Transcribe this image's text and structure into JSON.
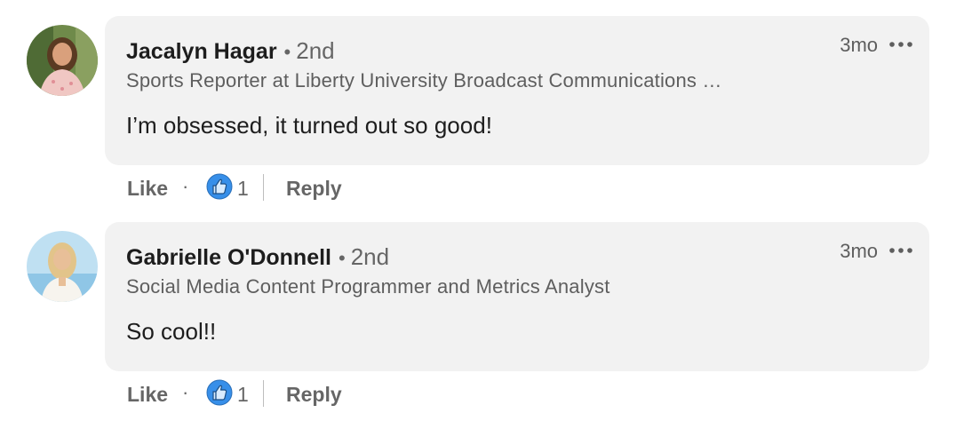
{
  "comments": [
    {
      "author": "Jacalyn Hagar",
      "degree": "2nd",
      "headline": "Sports Reporter at Liberty University Broadcast Communications …",
      "text": "I’m obsessed, it turned out so good!",
      "time": "3mo",
      "like_label": "Like",
      "reaction_count": "1",
      "reply_label": "Reply",
      "separator": "·",
      "degree_bullet": "•"
    },
    {
      "author": "Gabrielle O'Donnell",
      "degree": "2nd",
      "headline": "Social Media Content Programmer and Metrics Analyst",
      "text": "So cool!!",
      "time": "3mo",
      "like_label": "Like",
      "reaction_count": "1",
      "reply_label": "Reply",
      "separator": "·",
      "degree_bullet": "•"
    }
  ],
  "icons": {
    "more": "more-horizontal-icon",
    "reaction": "like-reaction-icon"
  },
  "colors": {
    "bubble": "#f2f2f2",
    "reaction_blue": "#378fe9",
    "text_primary": "#1d1d1d",
    "text_secondary": "#666666"
  }
}
